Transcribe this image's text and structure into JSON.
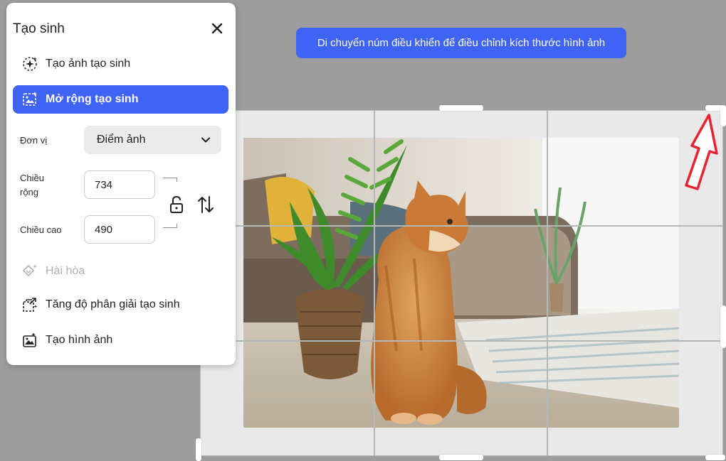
{
  "tooltip": {
    "text": "Di chuyển núm điều khiển để điều chỉnh kích thước hình ảnh"
  },
  "panel": {
    "title": "Tạo sinh",
    "close_icon": "close-icon",
    "menu_top": [
      {
        "label": "Tạo ảnh tạo sinh",
        "icon": "generative-sparkle-icon",
        "state": "normal"
      },
      {
        "label": "Mở rộng tạo sinh",
        "icon": "generative-expand-icon",
        "state": "active"
      }
    ],
    "unit_label": "Đơn vị",
    "unit_value": "Điểm ảnh",
    "width_label": "Chiều rộng",
    "width_value": "734",
    "height_label": "Chiều cao",
    "height_value": "490",
    "menu_bottom": [
      {
        "label": "Hài hòa",
        "icon": "harmonize-icon",
        "state": "disabled"
      },
      {
        "label": "Tăng độ phân giải tạo sinh",
        "icon": "upscale-icon",
        "state": "normal"
      },
      {
        "label": "Tạo hình ảnh",
        "icon": "generate-image-icon",
        "state": "normal"
      }
    ]
  },
  "colors": {
    "accent": "#3e63f5",
    "canvas_bg": "#9d9d9d",
    "frame_bg": "#e9e9e9",
    "arrow": "#e8232f"
  }
}
